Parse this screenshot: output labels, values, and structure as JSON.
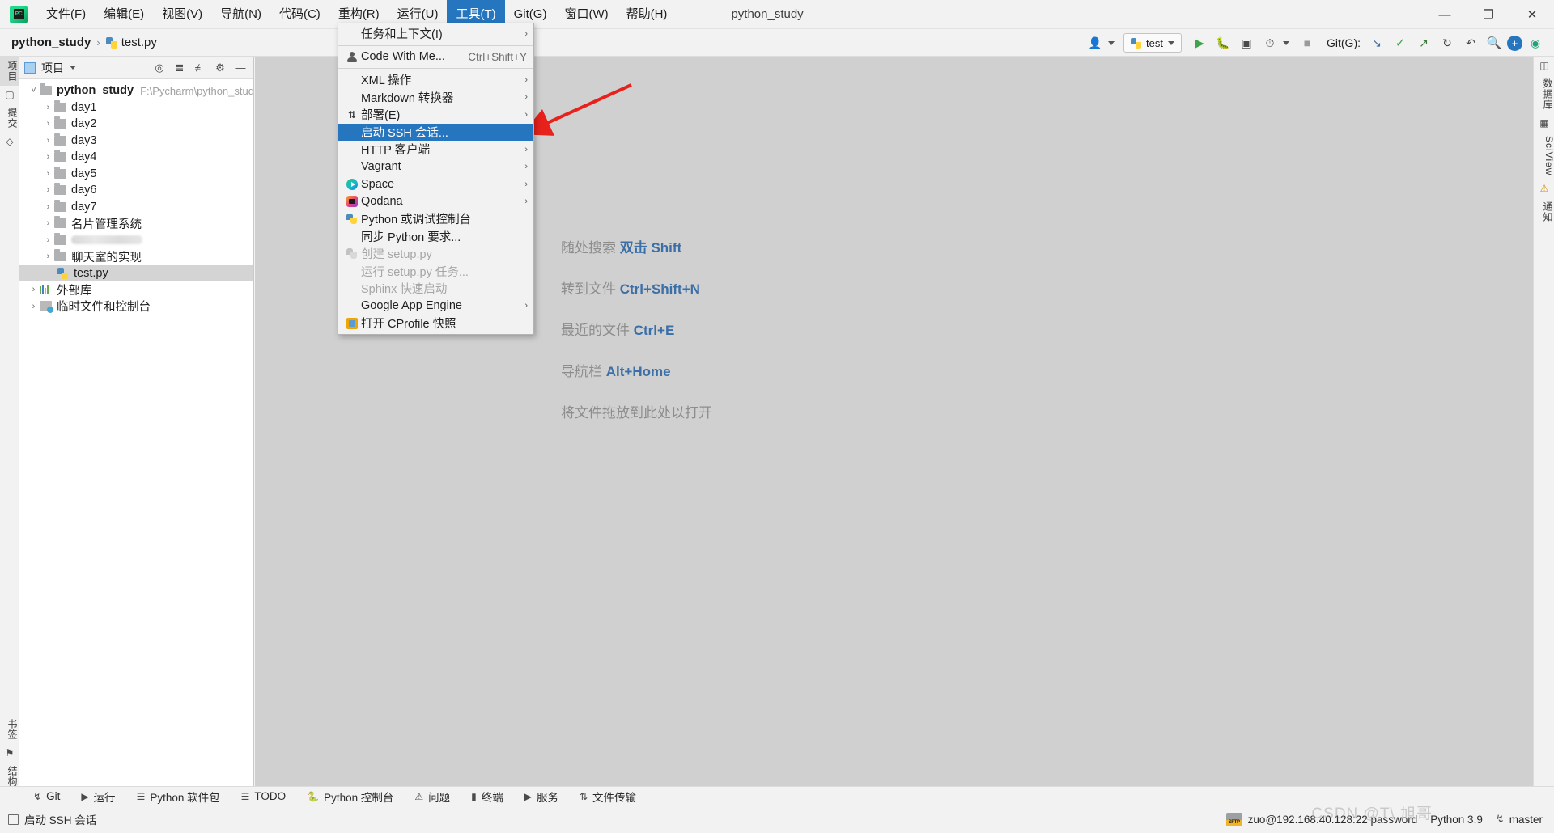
{
  "window": {
    "title": "python_study",
    "minimize": "—",
    "maximize": "❐",
    "close": "✕"
  },
  "menubar": {
    "items": [
      {
        "label": "文件(F)",
        "mnemonic": "F",
        "active": false
      },
      {
        "label": "编辑(E)",
        "mnemonic": "E",
        "active": false
      },
      {
        "label": "视图(V)",
        "mnemonic": "V",
        "active": false
      },
      {
        "label": "导航(N)",
        "mnemonic": "N",
        "active": false
      },
      {
        "label": "代码(C)",
        "mnemonic": "C",
        "active": false
      },
      {
        "label": "重构(R)",
        "mnemonic": "R",
        "active": false
      },
      {
        "label": "运行(U)",
        "mnemonic": "U",
        "active": false
      },
      {
        "label": "工具(T)",
        "mnemonic": "T",
        "active": true
      },
      {
        "label": "Git(G)",
        "mnemonic": "G",
        "active": false
      },
      {
        "label": "窗口(W)",
        "mnemonic": "W",
        "active": false
      },
      {
        "label": "帮助(H)",
        "mnemonic": "H",
        "active": false
      }
    ]
  },
  "tools_menu": {
    "items": [
      {
        "label": "任务和上下文(I)",
        "icon": "",
        "shortcut": "",
        "submenu": true,
        "disabled": false,
        "selected": false
      },
      {
        "label": "Code With Me...",
        "icon": "person-icon",
        "shortcut": "Ctrl+Shift+Y",
        "submenu": false,
        "disabled": false,
        "selected": false,
        "separator_before": true
      },
      {
        "label": "XML 操作",
        "icon": "",
        "shortcut": "",
        "submenu": true,
        "disabled": false,
        "selected": false,
        "separator_before": true
      },
      {
        "label": "Markdown 转换器",
        "icon": "",
        "shortcut": "",
        "submenu": true,
        "disabled": false,
        "selected": false
      },
      {
        "label": "部署(E)",
        "icon": "deploy-icon",
        "shortcut": "",
        "submenu": true,
        "disabled": false,
        "selected": false
      },
      {
        "label": "启动 SSH 会话...",
        "icon": "",
        "shortcut": "",
        "submenu": false,
        "disabled": false,
        "selected": true
      },
      {
        "label": "HTTP 客户端",
        "icon": "",
        "shortcut": "",
        "submenu": true,
        "disabled": false,
        "selected": false
      },
      {
        "label": "Vagrant",
        "icon": "",
        "shortcut": "",
        "submenu": true,
        "disabled": false,
        "selected": false
      },
      {
        "label": "Space",
        "icon": "space-icon",
        "shortcut": "",
        "submenu": true,
        "disabled": false,
        "selected": false
      },
      {
        "label": "Qodana",
        "icon": "qodana-icon",
        "shortcut": "",
        "submenu": true,
        "disabled": false,
        "selected": false
      },
      {
        "label": "Python 或调试控制台",
        "icon": "python-icon",
        "shortcut": "",
        "submenu": false,
        "disabled": false,
        "selected": false
      },
      {
        "label": "同步 Python 要求...",
        "icon": "",
        "shortcut": "",
        "submenu": false,
        "disabled": false,
        "selected": false
      },
      {
        "label": "创建 setup.py",
        "icon": "python-icon-gray",
        "shortcut": "",
        "submenu": false,
        "disabled": true,
        "selected": false
      },
      {
        "label": "运行 setup.py 任务...",
        "icon": "",
        "shortcut": "",
        "submenu": false,
        "disabled": true,
        "selected": false
      },
      {
        "label": "Sphinx 快速启动",
        "icon": "",
        "shortcut": "",
        "submenu": false,
        "disabled": true,
        "selected": false
      },
      {
        "label": "Google App Engine",
        "icon": "",
        "shortcut": "",
        "submenu": true,
        "disabled": false,
        "selected": false
      },
      {
        "label": "打开 CProfile 快照",
        "icon": "cprofile-icon",
        "shortcut": "",
        "submenu": false,
        "disabled": false,
        "selected": false
      }
    ]
  },
  "breadcrumb": {
    "project": "python_study",
    "separator": "›",
    "file": "test.py"
  },
  "toolbar_right": {
    "run_config": "test",
    "git_label": "Git(G):",
    "search_icon": "search-icon",
    "add_icon": "plus-icon",
    "run_icon": "run-icon",
    "debug_icon": "debug-icon",
    "coverage_icon": "coverage-icon",
    "profile_icon": "profile-icon",
    "stop_icon": "stop-icon",
    "update_icon": "vcs-update-icon",
    "commit_icon": "vcs-commit-icon",
    "push_icon": "vcs-push-icon",
    "history_icon": "history-icon",
    "rollback_icon": "rollback-icon",
    "user_icon": "user-icon"
  },
  "left_strip": {
    "tabs": [
      "项目",
      "提交"
    ],
    "selected": "项目",
    "bottom_tabs": [
      "书签",
      "结构"
    ]
  },
  "right_strip": {
    "tabs": [
      "数据库",
      "SciView",
      "通知"
    ]
  },
  "project_panel": {
    "title": "项目",
    "icons": [
      "locate-icon",
      "expand-all-icon",
      "collapse-all-icon",
      "settings-icon",
      "hide-icon"
    ],
    "tree": [
      {
        "label": "python_study",
        "path": "F:\\Pycharm\\python_study",
        "indent": 0,
        "arrow": "open",
        "icon": "folder-icon",
        "bold": true,
        "selected": false
      },
      {
        "label": "day1",
        "path": "",
        "indent": 1,
        "arrow": "closed",
        "icon": "folder-icon",
        "bold": false,
        "selected": false
      },
      {
        "label": "day2",
        "path": "",
        "indent": 1,
        "arrow": "closed",
        "icon": "folder-icon",
        "bold": false,
        "selected": false
      },
      {
        "label": "day3",
        "path": "",
        "indent": 1,
        "arrow": "closed",
        "icon": "folder-icon",
        "bold": false,
        "selected": false
      },
      {
        "label": "day4",
        "path": "",
        "indent": 1,
        "arrow": "closed",
        "icon": "folder-icon",
        "bold": false,
        "selected": false
      },
      {
        "label": "day5",
        "path": "",
        "indent": 1,
        "arrow": "closed",
        "icon": "folder-icon",
        "bold": false,
        "selected": false
      },
      {
        "label": "day6",
        "path": "",
        "indent": 1,
        "arrow": "closed",
        "icon": "folder-icon",
        "bold": false,
        "selected": false
      },
      {
        "label": "day7",
        "path": "",
        "indent": 1,
        "arrow": "closed",
        "icon": "folder-icon",
        "bold": false,
        "selected": false
      },
      {
        "label": "名片管理系统",
        "path": "",
        "indent": 1,
        "arrow": "closed",
        "icon": "folder-icon",
        "bold": false,
        "selected": false
      },
      {
        "label": "",
        "path": "",
        "indent": 1,
        "arrow": "closed",
        "icon": "folder-icon",
        "bold": false,
        "selected": false,
        "blurred": true
      },
      {
        "label": "聊天室的实现",
        "path": "",
        "indent": 1,
        "arrow": "closed",
        "icon": "folder-icon",
        "bold": false,
        "selected": false
      },
      {
        "label": "test.py",
        "path": "",
        "indent": 2,
        "arrow": "none",
        "icon": "python-file-icon",
        "bold": false,
        "selected": true
      },
      {
        "label": "外部库",
        "path": "",
        "indent": 0,
        "arrow": "closed",
        "icon": "library-icon",
        "bold": false,
        "selected": false
      },
      {
        "label": "临时文件和控制台",
        "path": "",
        "indent": 0,
        "arrow": "closed",
        "icon": "scratch-icon",
        "bold": false,
        "selected": false
      }
    ]
  },
  "editor_hints": {
    "rows": [
      {
        "text": "随处搜索 ",
        "key": "双击 Shift"
      },
      {
        "text": "转到文件 ",
        "key": "Ctrl+Shift+N"
      },
      {
        "text": "最近的文件 ",
        "key": "Ctrl+E"
      },
      {
        "text": "导航栏 ",
        "key": "Alt+Home"
      }
    ],
    "drop_text": "将文件拖放到此处以打开"
  },
  "bottom_bar": {
    "items": [
      {
        "label": "Git",
        "icon": "git-icon"
      },
      {
        "label": "运行",
        "icon": "run-icon"
      },
      {
        "label": "Python 软件包",
        "icon": "packages-icon"
      },
      {
        "label": "TODO",
        "icon": "todo-icon"
      },
      {
        "label": "Python 控制台",
        "icon": "python-console-icon"
      },
      {
        "label": "问题",
        "icon": "problems-icon"
      },
      {
        "label": "终端",
        "icon": "terminal-icon"
      },
      {
        "label": "服务",
        "icon": "services-icon"
      },
      {
        "label": "文件传输",
        "icon": "file-transfer-icon"
      }
    ]
  },
  "status_bar": {
    "left_label": "启动 SSH 会话",
    "left_icon": "window-icon",
    "sftp": "zuo@192.168.40.128:22 password",
    "sftp_icon": "sftp-icon",
    "interpreter": "Python 3.9",
    "branch": "master",
    "branch_icon": "branch-icon",
    "watermark": "CSDN @T\\ 旭哥"
  },
  "colors": {
    "accent": "#2675bf",
    "selection": "#d4d4d4",
    "editor_bg": "#d0d0d0",
    "panel_bg": "#f2f2f2",
    "annotation_arrow": "#e8211c",
    "hint_key": "#3b6fa8"
  }
}
